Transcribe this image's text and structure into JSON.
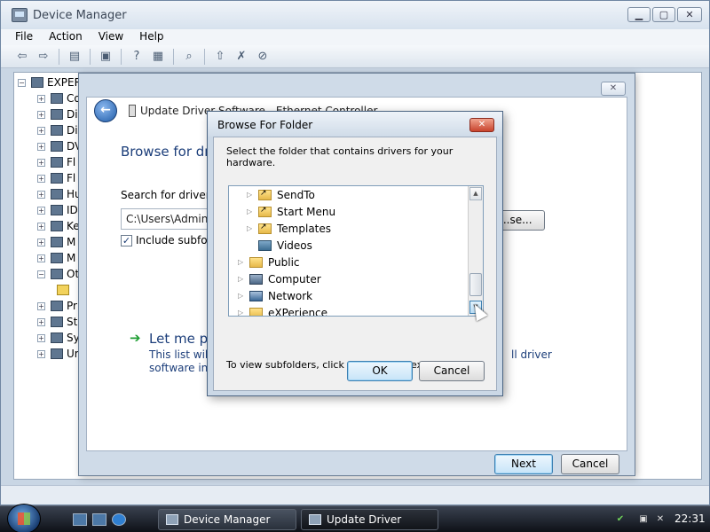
{
  "device_manager": {
    "title": "Device Manager",
    "menu": [
      {
        "label": "File"
      },
      {
        "label": "Action"
      },
      {
        "label": "View"
      },
      {
        "label": "Help"
      }
    ],
    "tree": {
      "root": "EXPER",
      "items": [
        "Co",
        "Di",
        "Di",
        "DV",
        "Fl",
        "Fl",
        "Hu",
        "ID",
        "Ke",
        "M",
        "M",
        "Ot",
        "",
        "Pr",
        "St",
        "Sy",
        "Ur"
      ]
    }
  },
  "wizard": {
    "title": "Update Driver Software - Ethernet Controller",
    "heading": "Browse for dri",
    "search_label": "Search for driver so",
    "path_value": "C:\\Users\\Adminis",
    "browse_label": "...se...",
    "include_subfolders_label": "Include subfold",
    "include_subfolders_checked": true,
    "let_me_pick": "Let me pi",
    "desc_line1": "This list will s",
    "desc_line2": "software in t",
    "desc_right": "ll driver",
    "next_label": "Next",
    "cancel_label": "Cancel"
  },
  "browse_dialog": {
    "title": "Browse For Folder",
    "instruction": "Select the folder that contains drivers for your hardware.",
    "folders": [
      {
        "label": "SendTo",
        "icon": "shortcut-folder-icon"
      },
      {
        "label": "Start Menu",
        "icon": "shortcut-folder-icon"
      },
      {
        "label": "Templates",
        "icon": "shortcut-folder-icon"
      },
      {
        "label": "Videos",
        "icon": "videos-folder-icon"
      },
      {
        "label": "Public",
        "icon": "folder-icon"
      },
      {
        "label": "Computer",
        "icon": "computer-icon"
      },
      {
        "label": "Network",
        "icon": "network-icon"
      },
      {
        "label": "eXPerience",
        "icon": "folder-icon"
      }
    ],
    "hint": "To view subfolders, click the symbol next to a folder.",
    "ok_label": "OK",
    "cancel_label": "Cancel"
  },
  "taskbar": {
    "tasks": [
      {
        "label": "Device Manager"
      },
      {
        "label": "Update Driver Softw..."
      }
    ],
    "clock": "22:31"
  }
}
